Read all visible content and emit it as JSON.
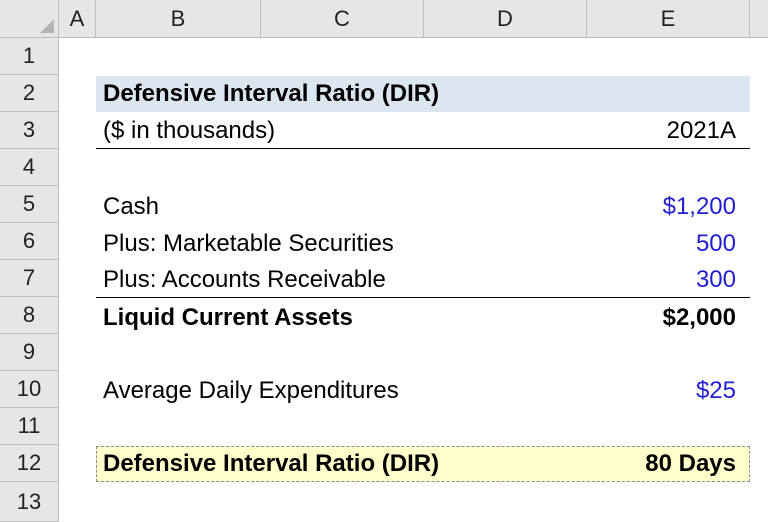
{
  "columns": [
    "A",
    "B",
    "C",
    "D",
    "E"
  ],
  "rows": [
    "1",
    "2",
    "3",
    "4",
    "5",
    "6",
    "7",
    "8",
    "9",
    "10",
    "11",
    "12",
    "13"
  ],
  "title": "Defensive Interval Ratio (DIR)",
  "units": "($ in thousands)",
  "period": "2021A",
  "items": [
    {
      "label": "Cash",
      "value": "$1,200"
    },
    {
      "label": "Plus: Marketable Securities",
      "value": "500"
    },
    {
      "label": "Plus: Accounts Receivable",
      "value": "300"
    }
  ],
  "subtotal": {
    "label": "Liquid Current Assets",
    "value": "$2,000"
  },
  "expenditures": {
    "label": "Average Daily Expenditures",
    "value": "$25"
  },
  "result": {
    "label": "Defensive Interval Ratio (DIR)",
    "value": "80 Days"
  },
  "colors": {
    "input_blue": "#1f1fd1",
    "title_fill": "#dce6f1",
    "result_fill": "#ffffcc",
    "header_fill": "#e6e6e6"
  }
}
